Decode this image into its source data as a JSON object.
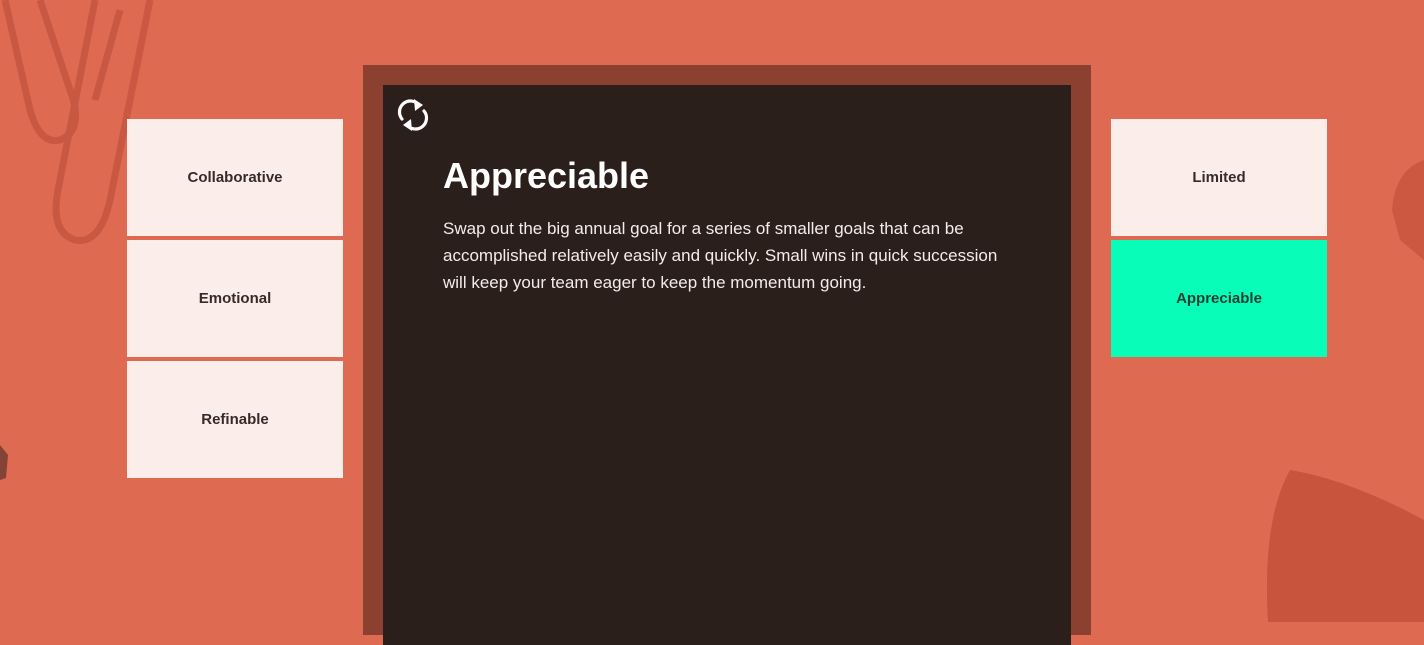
{
  "left_cards": [
    {
      "label": "Collaborative"
    },
    {
      "label": "Emotional"
    },
    {
      "label": "Refinable"
    }
  ],
  "right_cards": [
    {
      "label": "Limited",
      "active": false
    },
    {
      "label": "Appreciable",
      "active": true
    }
  ],
  "detail": {
    "title": "Appreciable",
    "description": "Swap out the big annual goal for a series of smaller goals that can be accomplished relatively easily and quickly. Small wins in quick succession will keep your team eager to keep the momentum going."
  },
  "icons": {
    "refresh": "refresh-icon"
  },
  "colors": {
    "background": "#de6a52",
    "frame": "#8c4030",
    "panel": "#2b1f1c",
    "card": "#fbeeea",
    "active_card": "#08fdb8"
  }
}
